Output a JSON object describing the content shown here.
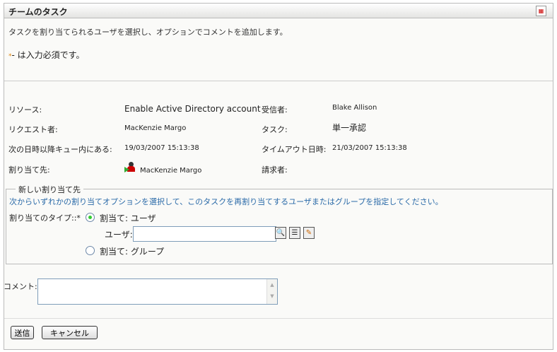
{
  "header": {
    "title": "チームのタスク",
    "menu_icon": "grid-menu-icon"
  },
  "intro": {
    "description": "タスクを割り当てられるユーザを選択し、オプションでコメントを追加します。",
    "required_marker": "*",
    "required_note": "- は入力必須です。"
  },
  "details": {
    "resource_label": "リソース:",
    "resource_value": "Enable Active Directory account",
    "recipient_label": "受信者:",
    "recipient_value": "Blake Allison",
    "requester_label": "リクエスト者:",
    "requester_value": "MacKenzie Margo",
    "task_label": "タスク:",
    "task_value": "単一承認",
    "queued_label": "次の日時以降キュー内にある:",
    "queued_value": "19/03/2007 15:13:38",
    "timeout_label": "タイムアウト日時:",
    "timeout_value": "21/03/2007 15:13:38",
    "assignee_label": "割り当て先:",
    "assignee_value": "MacKenzie Margo",
    "claimer_label": "請求者:"
  },
  "reassign": {
    "legend": "新しい割り当て先",
    "instructions": "次からいずれかの割り当てオプションを選択して、このタスクを再割り当てするユーザまたはグループを指定してください。",
    "type_label": "割り当てのタイプ::*",
    "option_user": "割当て: ユーザ",
    "option_group": "割当て: グループ",
    "user_label": "ユーザ:",
    "user_value": ""
  },
  "comment": {
    "label": "コメント:",
    "value": ""
  },
  "buttons": {
    "submit": "送信",
    "cancel": "キャンセル"
  }
}
